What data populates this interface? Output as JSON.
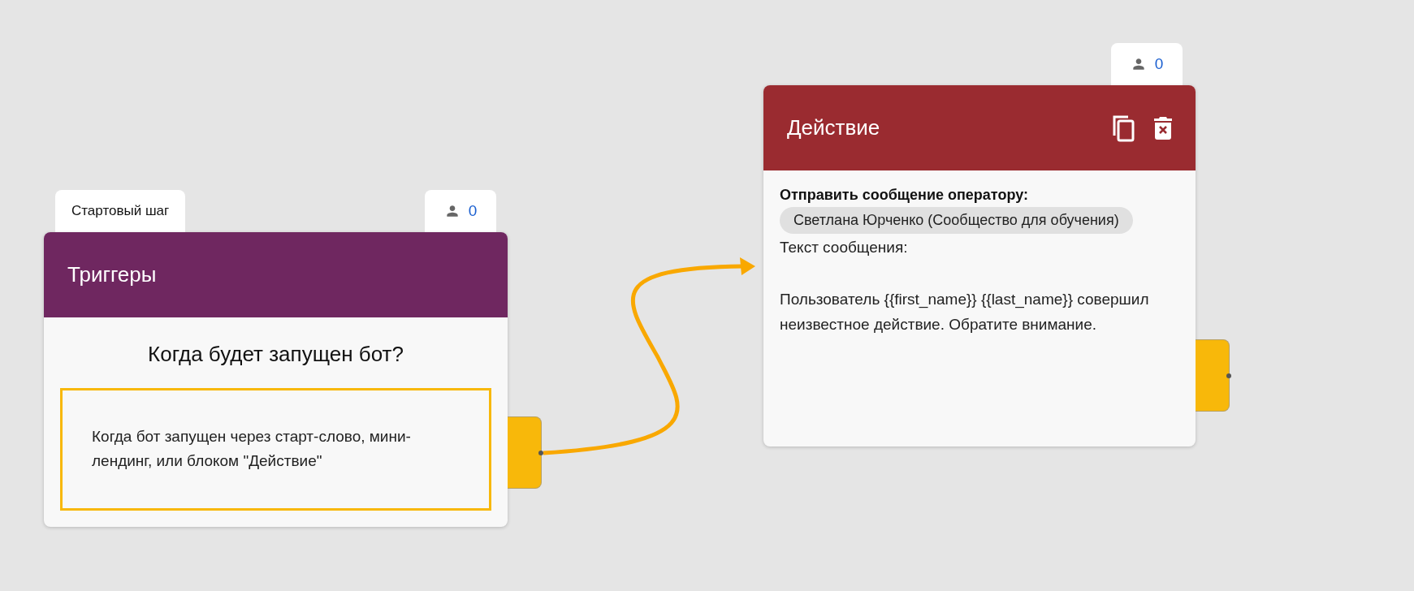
{
  "nodes": [
    {
      "kind": "trigger",
      "step_label": "Стартовый шаг",
      "subscriber_count": "0",
      "title": "Триггеры",
      "question": "Когда будет запущен бот?",
      "triggers": [
        {
          "text": "Когда бот запущен через старт-слово, мини-лендинг, или блоком \"Действие\""
        }
      ]
    },
    {
      "kind": "action",
      "subscriber_count": "0",
      "title": "Действие",
      "action_label": "Отправить сообщение оператору:",
      "recipient": "Светлана Юрченко (Сообщество для обучения)",
      "message_label": "Текст сообщения:",
      "message": "Пользователь {{first_name}} {{last_name}} совершил неизвестное действие. Обратите внимание."
    }
  ]
}
